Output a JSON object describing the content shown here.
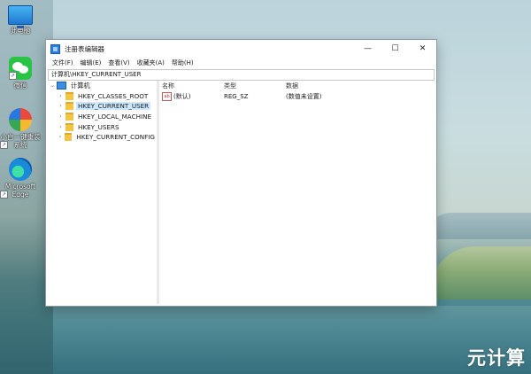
{
  "desktop": {
    "icons": [
      {
        "name": "computer",
        "label": "此电脑"
      },
      {
        "name": "wechat",
        "label": "微信"
      },
      {
        "name": "mini-program",
        "label": "小白一键重装系统"
      },
      {
        "name": "edge",
        "label": "Microsoft Edge"
      }
    ]
  },
  "window": {
    "title": "注册表编辑器",
    "controls": {
      "minimize": "—",
      "maximize": "☐",
      "close": "✕"
    },
    "menu": [
      "文件(F)",
      "编辑(E)",
      "查看(V)",
      "收藏夹(A)",
      "帮助(H)"
    ],
    "address": "计算机\\HKEY_CURRENT_USER",
    "tree": {
      "root": "计算机",
      "children": [
        "HKEY_CLASSES_ROOT",
        "HKEY_CURRENT_USER",
        "HKEY_LOCAL_MACHINE",
        "HKEY_USERS",
        "HKEY_CURRENT_CONFIG"
      ],
      "selected": "HKEY_CURRENT_USER"
    },
    "list": {
      "columns": [
        "名称",
        "类型",
        "数据"
      ],
      "rows": [
        {
          "name": "(默认)",
          "type": "REG_SZ",
          "data": "(数值未设置)",
          "icon": "ab"
        }
      ]
    }
  },
  "watermark": "元计算"
}
